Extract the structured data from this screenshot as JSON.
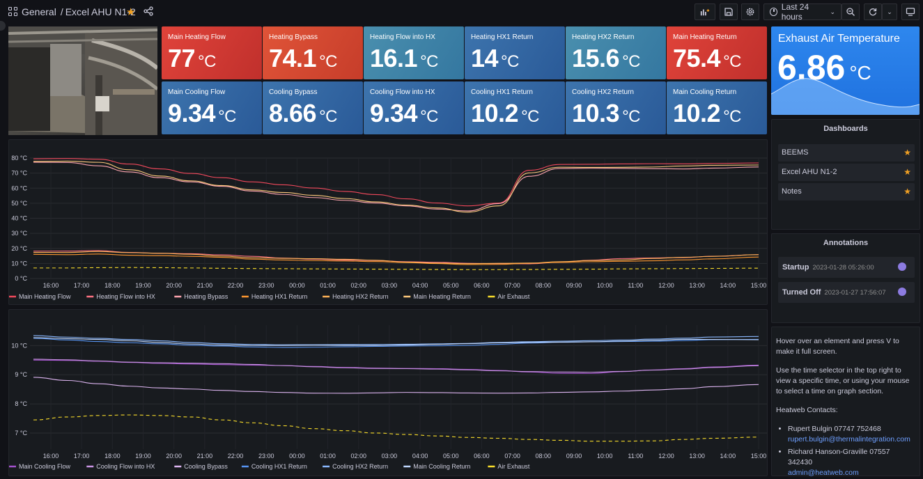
{
  "header": {
    "breadcrumb_folder": "General",
    "breadcrumb_separator": "/",
    "breadcrumb_dashboard": "Excel AHU N1-2",
    "time_range": "Last 24 hours",
    "icons": [
      "apps-icon",
      "star-icon",
      "share-icon",
      "add-panel-icon",
      "save-icon",
      "settings-icon",
      "clock-icon",
      "zoom-out-icon",
      "refresh-icon",
      "monitor-icon"
    ]
  },
  "stats": [
    {
      "label": "Main Heating Flow",
      "value": "77",
      "unit": "°C",
      "color": "#d63a33"
    },
    {
      "label": "Heating Bypass",
      "value": "74.1",
      "unit": "°C",
      "color": "#d64a30"
    },
    {
      "label": "Heating Flow into HX",
      "value": "16.1",
      "unit": "°C",
      "color": "#3f86a8"
    },
    {
      "label": "Heating HX1 Return",
      "value": "14",
      "unit": "°C",
      "color": "#3a7aa8"
    },
    {
      "label": "Heating HX2 Return",
      "value": "15.6",
      "unit": "°C",
      "color": "#3f86a8"
    },
    {
      "label": "Main Heating Return",
      "value": "75.4",
      "unit": "°C",
      "color": "#d63a33"
    },
    {
      "label": "Main Cooling Flow",
      "value": "9.34",
      "unit": "°C",
      "color": "#3467a3"
    },
    {
      "label": "Cooling Bypass",
      "value": "8.66",
      "unit": "°C",
      "color": "#3467a3"
    },
    {
      "label": "Cooling Flow into HX",
      "value": "9.34",
      "unit": "°C",
      "color": "#3467a3"
    },
    {
      "label": "Cooling HX1 Return",
      "value": "10.2",
      "unit": "°C",
      "color": "#3467a3"
    },
    {
      "label": "Cooling HX2 Return",
      "value": "10.3",
      "unit": "°C",
      "color": "#3467a3"
    },
    {
      "label": "Main Cooling Return",
      "value": "10.2",
      "unit": "°C",
      "color": "#3467a3"
    }
  ],
  "exhaust": {
    "label": "Exhaust Air Temperature",
    "value": "6.86",
    "unit": "°C"
  },
  "dashboards": {
    "title": "Dashboards",
    "items": [
      {
        "label": "BEEMS"
      },
      {
        "label": "Excel AHU N1-2"
      },
      {
        "label": "Notes"
      }
    ]
  },
  "annotations": {
    "title": "Annotations",
    "items": [
      {
        "label": "Startup",
        "time": "2023-01-28 05:26:00"
      },
      {
        "label": "Turned Off",
        "time": "2023-01-27 17:56:07"
      }
    ]
  },
  "info": {
    "p1": "Hover over an element and press V to make it full screen.",
    "p2": "Use the time selector in the top right to view a specific time, or using your mouse to select a time on graph section.",
    "p3": "Heatweb Contacts:",
    "contacts": [
      {
        "name": "Rupert Bulgin 07747 752468",
        "email": "rupert.bulgin@thermalintegration.com"
      },
      {
        "name": "Richard Hanson-Graville 07557 342430",
        "email": "admin@heatweb.com"
      }
    ]
  },
  "chart_data": [
    {
      "type": "line",
      "x": [
        "16:00",
        "17:00",
        "18:00",
        "19:00",
        "20:00",
        "21:00",
        "22:00",
        "23:00",
        "00:00",
        "01:00",
        "02:00",
        "03:00",
        "04:00",
        "05:00",
        "06:00",
        "07:00",
        "08:00",
        "09:00",
        "10:00",
        "11:00",
        "12:00",
        "13:00",
        "14:00",
        "15:00"
      ],
      "y_ticks": [
        "0 °C",
        "10 °C",
        "20 °C",
        "30 °C",
        "40 °C",
        "50 °C",
        "60 °C",
        "70 °C",
        "80 °C"
      ],
      "ylim": [
        0,
        80
      ],
      "series": [
        {
          "name": "Main Heating Flow",
          "color": "#f2495c",
          "dashed": false,
          "values": [
            79.5,
            79.5,
            79,
            76,
            73,
            70,
            67,
            64,
            62,
            60,
            58,
            56,
            53,
            50,
            48,
            50,
            72,
            76,
            76,
            76,
            76,
            76,
            76.5,
            77
          ]
        },
        {
          "name": "Heating Flow into HX",
          "color": "#ff7383",
          "dashed": false,
          "values": [
            18,
            18,
            18.5,
            17.5,
            17,
            16.5,
            15.5,
            14.5,
            13.5,
            13,
            12.5,
            12,
            11,
            10.5,
            10,
            10,
            10,
            11,
            12,
            13,
            13.5,
            14,
            15,
            16
          ]
        },
        {
          "name": "Heating Bypass",
          "color": "#ffa6b0",
          "dashed": false,
          "values": [
            77,
            77,
            75,
            71,
            67,
            64,
            61,
            58,
            56,
            54,
            52,
            50,
            48,
            46,
            45,
            50,
            68,
            73,
            73,
            73,
            73,
            73,
            73.5,
            74
          ]
        },
        {
          "name": "Heating HX1 Return",
          "color": "#ff9830",
          "dashed": false,
          "values": [
            16,
            16,
            16.5,
            15.5,
            15,
            14.5,
            14,
            13,
            12.5,
            12,
            11.5,
            11,
            10.5,
            10,
            9.5,
            9.5,
            10,
            10.5,
            11,
            11.5,
            12,
            12.5,
            13,
            14
          ]
        },
        {
          "name": "Heating HX2 Return",
          "color": "#ffb357",
          "dashed": false,
          "values": [
            17.5,
            17.5,
            18,
            17,
            16.5,
            16,
            15,
            14,
            13.5,
            13,
            12.5,
            12,
            11,
            10.5,
            10,
            10,
            10,
            11,
            12,
            12.5,
            13.5,
            14,
            14.5,
            15.6
          ]
        },
        {
          "name": "Main Heating Return",
          "color": "#ffcb7d",
          "dashed": false,
          "values": [
            78,
            78,
            77,
            72,
            68,
            65,
            62,
            59,
            57,
            55,
            53,
            51,
            49,
            47,
            44,
            48,
            70,
            74,
            74,
            74,
            74,
            74.5,
            75,
            75.4
          ]
        },
        {
          "name": "Air Exhaust",
          "color": "#fade2a",
          "dashed": true,
          "values": [
            7,
            7,
            7.2,
            7.3,
            7.2,
            7,
            6.8,
            6.6,
            6.5,
            6.4,
            6.3,
            6.2,
            6.1,
            6,
            5.9,
            5.9,
            6,
            6.1,
            6.2,
            6.4,
            6.5,
            6.6,
            6.7,
            6.86
          ]
        }
      ]
    },
    {
      "type": "line",
      "x": [
        "16:00",
        "17:00",
        "18:00",
        "19:00",
        "20:00",
        "21:00",
        "22:00",
        "23:00",
        "00:00",
        "01:00",
        "02:00",
        "03:00",
        "04:00",
        "05:00",
        "06:00",
        "07:00",
        "08:00",
        "09:00",
        "10:00",
        "11:00",
        "12:00",
        "13:00",
        "14:00",
        "15:00"
      ],
      "y_ticks": [
        "7 °C",
        "8 °C",
        "9 °C",
        "10 °C"
      ],
      "ylim": [
        6.45,
        10.7
      ],
      "series": [
        {
          "name": "Main Cooling Flow",
          "color": "#a352cc",
          "dashed": false,
          "values": [
            9.5,
            9.48,
            9.45,
            9.42,
            9.4,
            9.38,
            9.35,
            9.32,
            9.3,
            9.28,
            9.26,
            9.24,
            9.22,
            9.2,
            9.17,
            9.14,
            9.1,
            9.06,
            9.05,
            9.1,
            9.15,
            9.2,
            9.27,
            9.34
          ]
        },
        {
          "name": "Cooling Flow into HX",
          "color": "#ca95e5",
          "dashed": false,
          "values": [
            9.52,
            9.5,
            9.47,
            9.44,
            9.42,
            9.4,
            9.37,
            9.34,
            9.31,
            9.28,
            9.25,
            9.22,
            9.2,
            9.18,
            9.16,
            9.14,
            9.12,
            9.1,
            9.08,
            9.1,
            9.15,
            9.2,
            9.26,
            9.32
          ]
        },
        {
          "name": "Cooling Bypass",
          "color": "#deb6f2",
          "dashed": false,
          "values": [
            8.9,
            8.8,
            8.7,
            8.62,
            8.55,
            8.5,
            8.45,
            8.42,
            8.4,
            8.38,
            8.37,
            8.37,
            8.38,
            8.38,
            8.38,
            8.38,
            8.38,
            8.39,
            8.4,
            8.43,
            8.48,
            8.53,
            8.6,
            8.66
          ]
        },
        {
          "name": "Cooling HX1 Return",
          "color": "#5794f2",
          "dashed": false,
          "values": [
            10.25,
            10.2,
            10.15,
            10.1,
            10.05,
            10,
            9.98,
            9.96,
            9.95,
            9.95,
            9.95,
            9.96,
            9.98,
            10,
            10.02,
            10.05,
            10.08,
            10.1,
            10.12,
            10.14,
            10.16,
            10.18,
            10.2,
            10.2
          ]
        },
        {
          "name": "Cooling HX2 Return",
          "color": "#8ab8ff",
          "dashed": false,
          "values": [
            10.35,
            10.3,
            10.25,
            10.2,
            10.15,
            10.1,
            10.07,
            10.05,
            10.03,
            10.02,
            10.02,
            10.03,
            10.05,
            10.07,
            10.08,
            10.1,
            10.12,
            10.14,
            10.17,
            10.2,
            10.23,
            10.25,
            10.28,
            10.3
          ]
        },
        {
          "name": "Main Cooling Return",
          "color": "#c0d8ff",
          "dashed": false,
          "values": [
            10.28,
            10.24,
            10.2,
            10.15,
            10.1,
            10.06,
            10.03,
            10.01,
            10,
            10,
            10,
            10.01,
            10.03,
            10.05,
            10.06,
            10.08,
            10.1,
            10.12,
            10.14,
            10.16,
            10.18,
            10.2,
            10.2,
            10.2
          ]
        },
        {
          "name": "Air Exhaust",
          "color": "#fade2a",
          "dashed": true,
          "values": [
            7.45,
            7.55,
            7.6,
            7.62,
            7.6,
            7.55,
            7.45,
            7.35,
            7.25,
            7.15,
            7.08,
            7.0,
            6.95,
            6.9,
            6.85,
            6.82,
            6.78,
            6.75,
            6.72,
            6.72,
            6.73,
            6.78,
            6.82,
            6.86
          ]
        }
      ]
    }
  ]
}
